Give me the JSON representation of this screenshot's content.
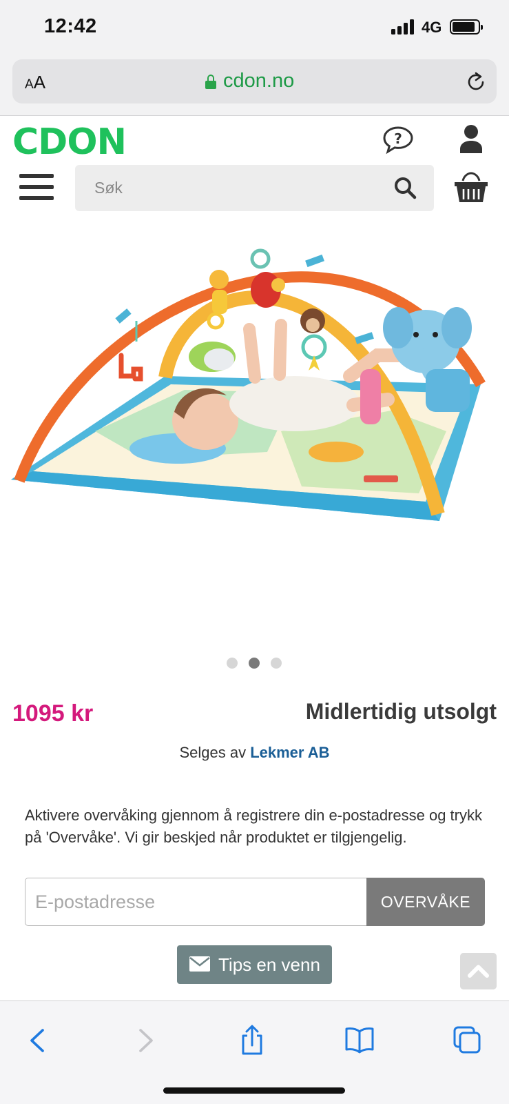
{
  "status_bar": {
    "time": "12:42",
    "network": "4G"
  },
  "browser": {
    "text_size_label_small": "A",
    "text_size_label_large": "A",
    "domain": "cdon.no",
    "accent_color": "#1d9a46"
  },
  "header": {
    "logo": "CDON",
    "logo_color": "#1fc15c",
    "search_placeholder": "Søk"
  },
  "product": {
    "image_icon": "baby-play-gym-photo",
    "carousel_total": 3,
    "carousel_active_index": 1,
    "price": "1095 kr",
    "price_color": "#d4197c",
    "stock_status": "Midlertidig utsolgt",
    "seller_prefix": "Selges av",
    "seller_name": "Lekmer AB"
  },
  "watch": {
    "notice": "Aktivere overvåking gjennom å registrere din e-postadresse og trykk på 'Overvåke'. Vi gir beskjed når produktet er tilgjengelig.",
    "email_value": "",
    "email_placeholder": "E-postadresse",
    "button_label": "OVERVÅKE"
  },
  "share": {
    "tips_label": "Tips en venn"
  },
  "toolbar": {
    "icons": [
      "back-icon",
      "forward-icon",
      "share-icon",
      "bookmarks-icon",
      "tabs-icon"
    ]
  }
}
